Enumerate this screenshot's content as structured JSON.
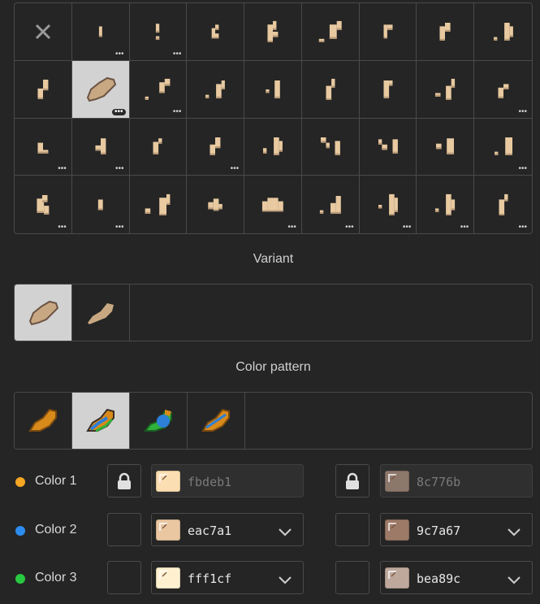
{
  "sections": {
    "variant_label": "Variant",
    "color_pattern_label": "Color pattern"
  },
  "grid": {
    "selected_index": 10,
    "cells": [
      {
        "icon": "close-icon",
        "more": false
      },
      {
        "icon": "sprite",
        "more": true
      },
      {
        "icon": "sprite",
        "more": true
      },
      {
        "icon": "sprite",
        "more": false
      },
      {
        "icon": "sprite",
        "more": false
      },
      {
        "icon": "sprite",
        "more": false
      },
      {
        "icon": "sprite",
        "more": false
      },
      {
        "icon": "sprite",
        "more": false
      },
      {
        "icon": "sprite",
        "more": false
      },
      {
        "icon": "sprite",
        "more": false
      },
      {
        "icon": "sprite",
        "more": true
      },
      {
        "icon": "sprite",
        "more": true
      },
      {
        "icon": "sprite",
        "more": false
      },
      {
        "icon": "sprite",
        "more": false
      },
      {
        "icon": "sprite",
        "more": false
      },
      {
        "icon": "sprite",
        "more": false
      },
      {
        "icon": "sprite",
        "more": false
      },
      {
        "icon": "sprite",
        "more": true
      },
      {
        "icon": "sprite",
        "more": true
      },
      {
        "icon": "sprite",
        "more": true
      },
      {
        "icon": "sprite",
        "more": false
      },
      {
        "icon": "sprite",
        "more": true
      },
      {
        "icon": "sprite",
        "more": false
      },
      {
        "icon": "sprite",
        "more": false
      },
      {
        "icon": "sprite",
        "more": false
      },
      {
        "icon": "sprite",
        "more": false
      },
      {
        "icon": "sprite",
        "more": true
      },
      {
        "icon": "sprite",
        "more": true
      },
      {
        "icon": "sprite",
        "more": true
      },
      {
        "icon": "sprite",
        "more": false
      },
      {
        "icon": "sprite",
        "more": false
      },
      {
        "icon": "sprite",
        "more": true
      },
      {
        "icon": "sprite",
        "more": true
      },
      {
        "icon": "sprite",
        "more": true
      },
      {
        "icon": "sprite",
        "more": true
      },
      {
        "icon": "sprite",
        "more": true
      }
    ],
    "more_glyph": "•••"
  },
  "colors": [
    {
      "label": "Color 1",
      "dot": "#f5a623",
      "locked": true,
      "hex1": "fbdeb1",
      "swatch1": "#fbdeb1",
      "hex2": "8c776b",
      "swatch2": "#8c776b",
      "disabled": true
    },
    {
      "label": "Color 2",
      "dot": "#2d8cf0",
      "locked": false,
      "hex1": "eac7a1",
      "swatch1": "#eac7a1",
      "hex2": "9c7a67",
      "swatch2": "#9c7a67",
      "disabled": false
    },
    {
      "label": "Color 3",
      "dot": "#28c840",
      "locked": false,
      "hex1": "fff1cf",
      "swatch1": "#fff1cf",
      "hex2": "bea89c",
      "swatch2": "#bea89c",
      "disabled": false
    }
  ],
  "palette": {
    "skin": "#e8c9a0",
    "skin_dark": "#b99a78",
    "outline": "#3a2e26",
    "orange": "#d88a1a",
    "blue": "#2d7fd8",
    "green": "#2eb23a"
  }
}
